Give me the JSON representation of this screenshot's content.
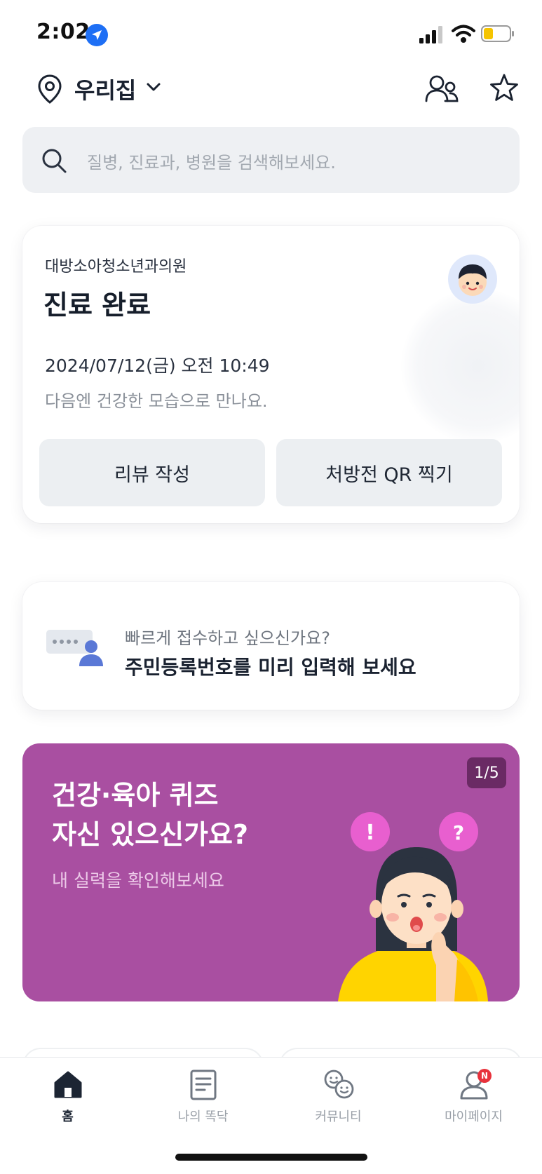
{
  "status_bar": {
    "time": "2:02"
  },
  "header": {
    "location": "우리집"
  },
  "search": {
    "placeholder": "질병, 진료과, 병원을 검색해보세요."
  },
  "visit_card": {
    "clinic": "대방소아청소년과의원",
    "status": "진료 완료",
    "datetime": "2024/07/12(금) 오전 10:49",
    "message": "다음엔 건강한 모습으로 만나요.",
    "review_button": "리뷰 작성",
    "qr_button": "처방전 QR 찍기"
  },
  "prereg_card": {
    "question": "빠르게 접수하고 싶으신가요?",
    "title": "주민등록번호를 미리 입력해 보세요"
  },
  "banner": {
    "title_line1": "건강·육아 퀴즈",
    "title_line2": "자신 있으신가요?",
    "subtitle": "내 실력을 확인해보세요",
    "page_indicator": "1/5",
    "bg_color": "#a94fa1"
  },
  "tabbar": {
    "tabs": [
      {
        "label": "홈",
        "icon": "home-icon",
        "active": true
      },
      {
        "label": "나의 똑닥",
        "icon": "document-icon",
        "active": false
      },
      {
        "label": "커뮤니티",
        "icon": "smiley-faces-icon",
        "active": false
      },
      {
        "label": "마이페이지",
        "icon": "person-icon",
        "active": false,
        "badge": "N"
      }
    ]
  }
}
